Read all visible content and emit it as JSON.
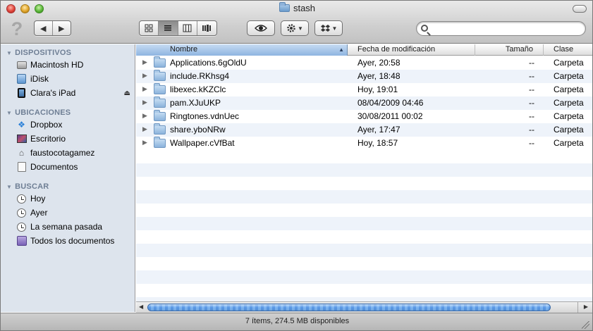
{
  "window": {
    "title": "stash"
  },
  "toolbar": {
    "nav_back": "◀",
    "nav_forward": "▶",
    "search": {
      "placeholder": "",
      "value": ""
    }
  },
  "sidebar": {
    "sections": [
      {
        "title": "DISPOSITIVOS",
        "items": [
          {
            "label": "Macintosh HD",
            "icon": "hard-drive-icon"
          },
          {
            "label": "iDisk",
            "icon": "idisk-icon"
          },
          {
            "label": "Clara's iPad",
            "icon": "ipad-icon",
            "ejectable": true
          }
        ]
      },
      {
        "title": "UBICACIONES",
        "items": [
          {
            "label": "Dropbox",
            "icon": "dropbox-icon"
          },
          {
            "label": "Escritorio",
            "icon": "desktop-icon"
          },
          {
            "label": "faustocotagamez",
            "icon": "home-icon"
          },
          {
            "label": "Documentos",
            "icon": "documents-icon"
          }
        ]
      },
      {
        "title": "BUSCAR",
        "items": [
          {
            "label": "Hoy",
            "icon": "clock-icon"
          },
          {
            "label": "Ayer",
            "icon": "clock-icon"
          },
          {
            "label": "La semana pasada",
            "icon": "clock-icon"
          },
          {
            "label": "Todos los documentos",
            "icon": "all-documents-icon"
          }
        ]
      }
    ]
  },
  "list": {
    "columns": {
      "name": "Nombre",
      "date": "Fecha de modificación",
      "size": "Tamaño",
      "kind": "Clase"
    },
    "sort": {
      "column": "name",
      "direction": "ascending"
    },
    "rows": [
      {
        "name": "Applications.6gOldU",
        "date": "Ayer, 20:58",
        "size": "--",
        "kind": "Carpeta"
      },
      {
        "name": "include.RKhsg4",
        "date": "Ayer, 18:48",
        "size": "--",
        "kind": "Carpeta"
      },
      {
        "name": "libexec.kKZClc",
        "date": "Hoy, 19:01",
        "size": "--",
        "kind": "Carpeta"
      },
      {
        "name": "pam.XJuUKP",
        "date": "08/04/2009 04:46",
        "size": "--",
        "kind": "Carpeta"
      },
      {
        "name": "Ringtones.vdnUec",
        "date": "30/08/2011 00:02",
        "size": "--",
        "kind": "Carpeta"
      },
      {
        "name": "share.yboNRw",
        "date": "Ayer, 17:47",
        "size": "--",
        "kind": "Carpeta"
      },
      {
        "name": "Wallpaper.cVfBat",
        "date": "Hoy, 18:57",
        "size": "--",
        "kind": "Carpeta"
      }
    ]
  },
  "status": {
    "text": "7 ítems, 274.5 MB disponibles"
  },
  "colors": {
    "sidebar_bg": "#dde4ed",
    "row_alt": "#eef3fa",
    "folder": "#8bb3dc",
    "accent": "#5a99e6"
  }
}
